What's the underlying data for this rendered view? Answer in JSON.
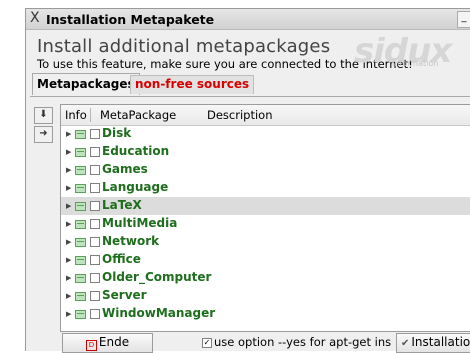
{
  "window": {
    "title": "Installation Metapakete",
    "title_icon": "X",
    "minimize_label": "_"
  },
  "header": {
    "headline": "Install additional metapackages",
    "subline": "To use this feature, make sure you are connected to the internet!",
    "logo_text": "sidux",
    "logo_subtext": "Information"
  },
  "tabs": [
    {
      "label": "Metapackages",
      "active": true
    },
    {
      "label": "non-free sources",
      "active": false
    }
  ],
  "side_buttons": {
    "down_symbol": "⬇",
    "right_symbol": "➜"
  },
  "columns": [
    "Info",
    "MetaPackage",
    "Description"
  ],
  "packages": [
    {
      "label": "Disk"
    },
    {
      "label": "Education"
    },
    {
      "label": "Games"
    },
    {
      "label": "Language"
    },
    {
      "label": "LaTeX",
      "selected": true
    },
    {
      "label": "MultiMedia"
    },
    {
      "label": "Network"
    },
    {
      "label": "Office"
    },
    {
      "label": "Older_Computer"
    },
    {
      "label": "Server"
    },
    {
      "label": "WindowManager"
    }
  ],
  "footer": {
    "ende_label": "Ende",
    "ende_icon": "D",
    "option_checked": true,
    "option_mark": "☑",
    "option_label": "use option --yes for apt-get ins",
    "install_label": "Installation",
    "install_icon": "✔"
  },
  "colors": {
    "package_label": "#1e6e1e",
    "inactive_tab_text": "#d80000",
    "selected_row": "#dcdcdc"
  }
}
